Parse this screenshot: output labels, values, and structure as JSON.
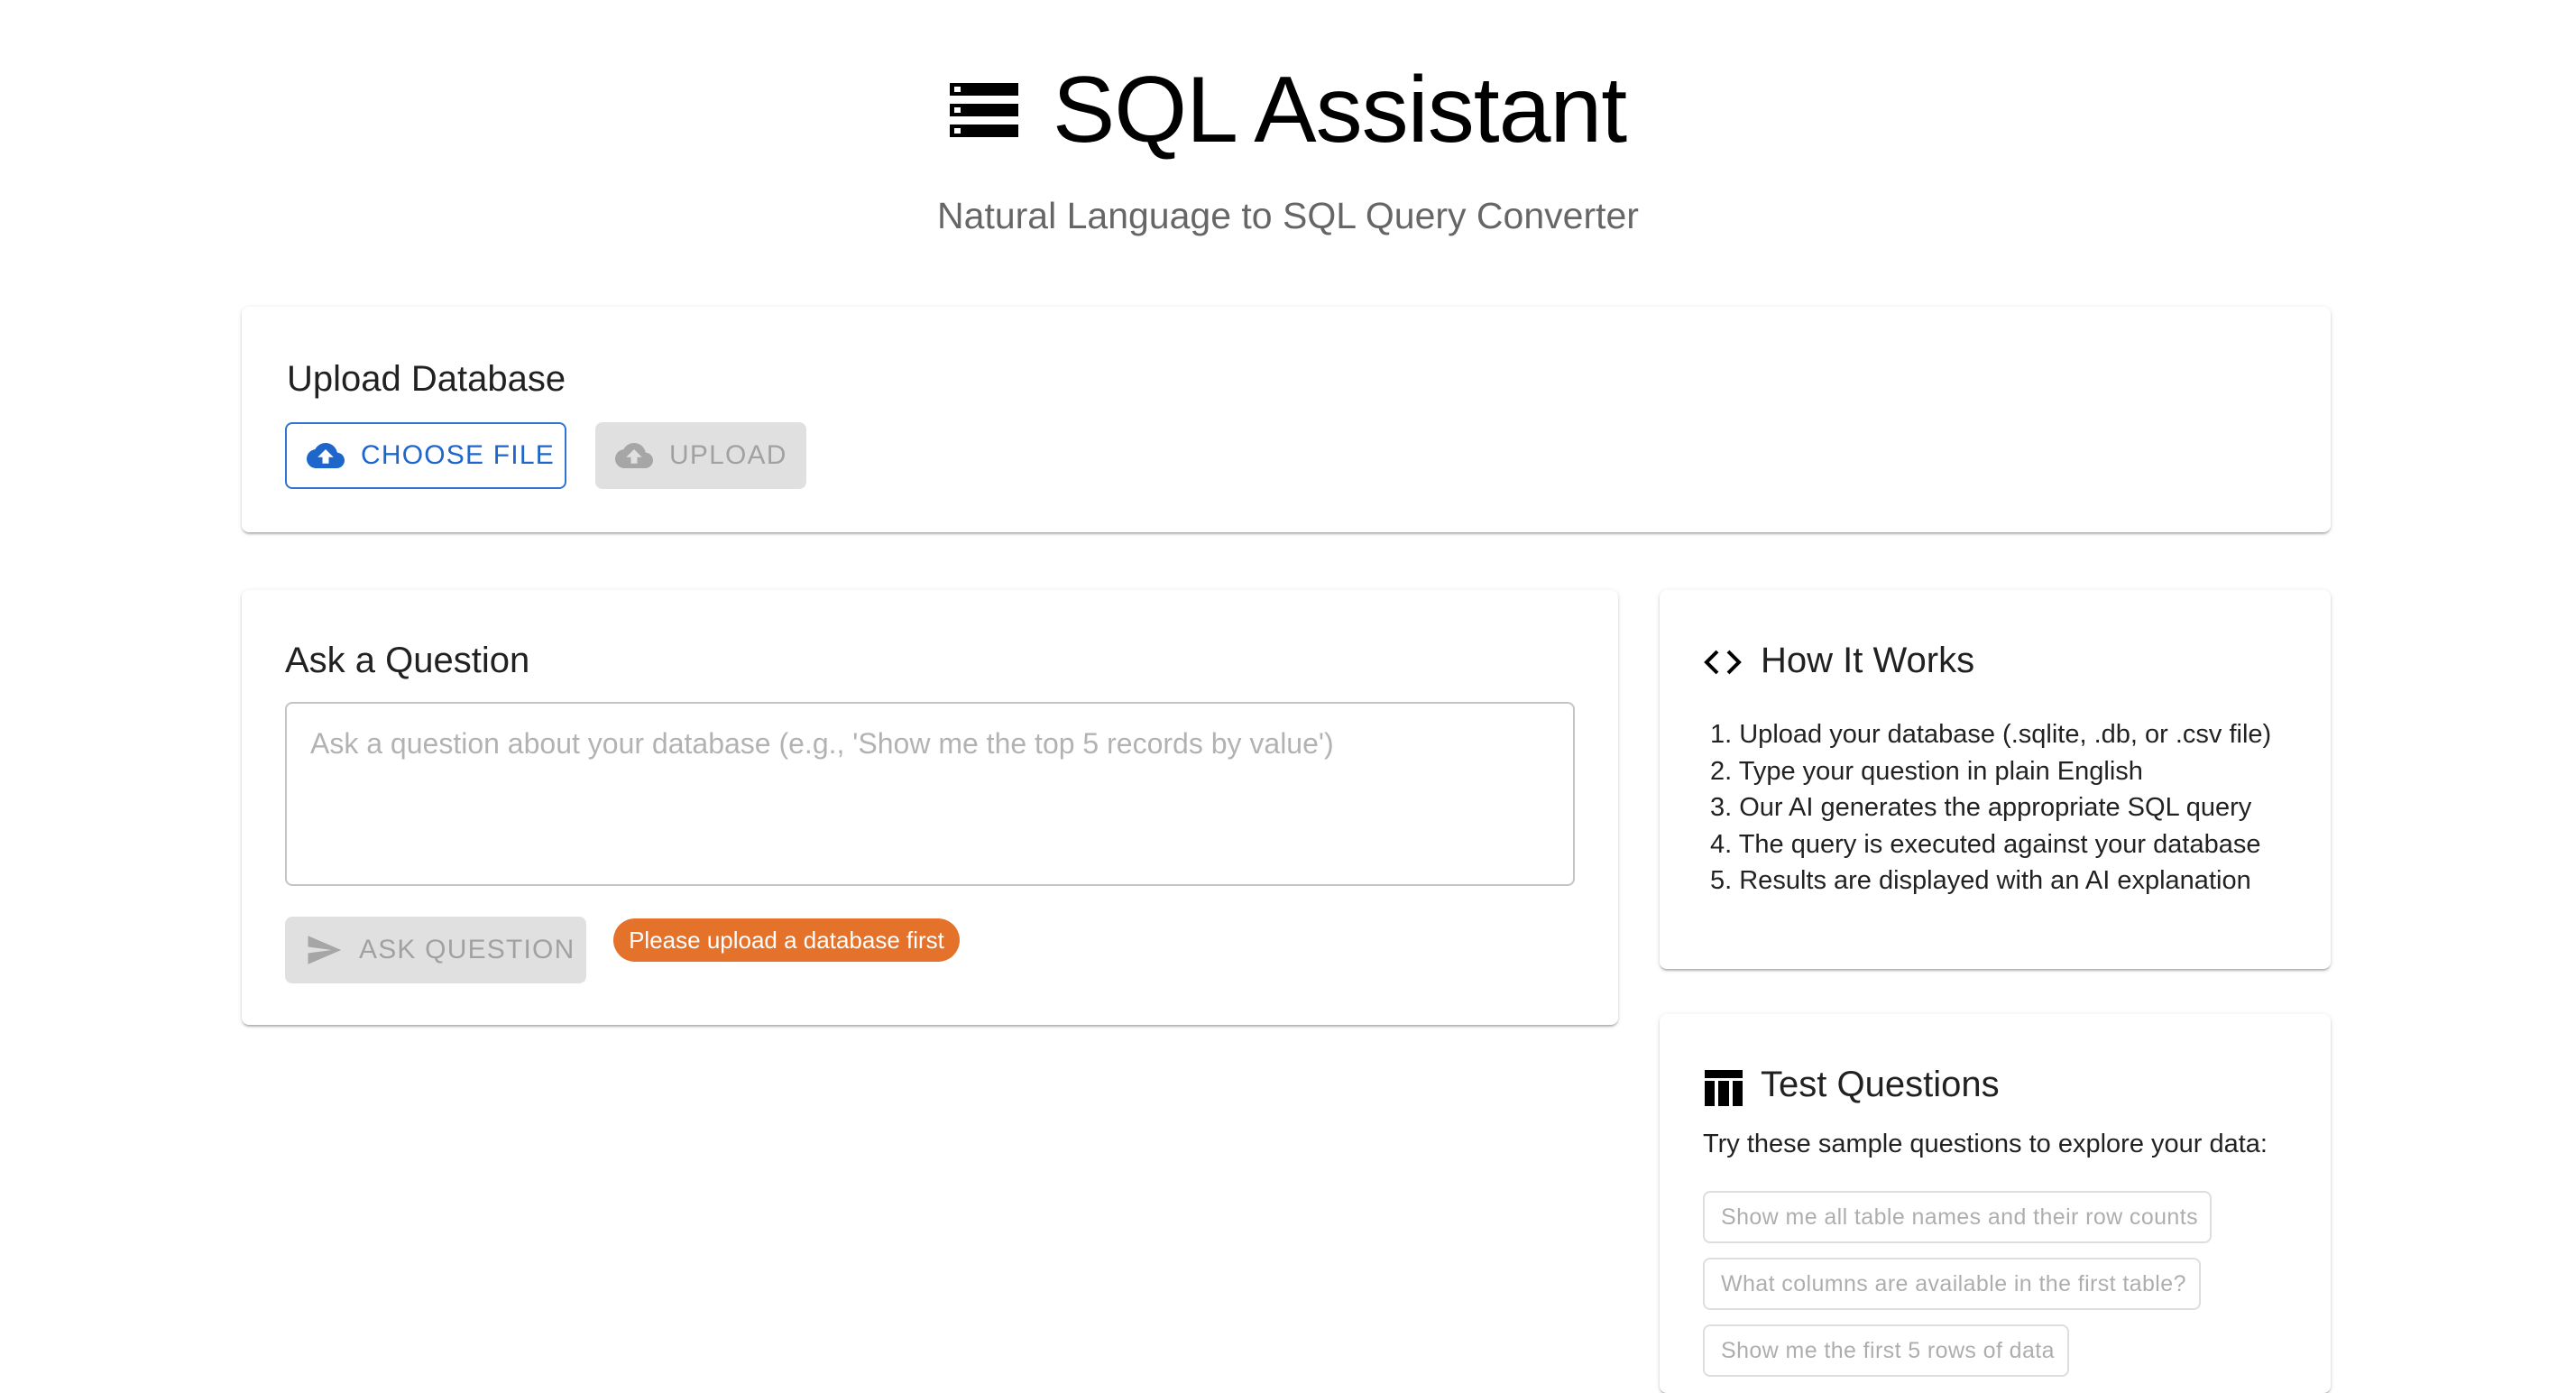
{
  "header": {
    "title": "SQL Assistant",
    "subtitle": "Natural Language to SQL Query Converter",
    "icon": "storage-icon"
  },
  "upload": {
    "title": "Upload Database",
    "choose_label": "CHOOSE FILE",
    "upload_label": "UPLOAD",
    "choose_icon": "cloud-upload-icon",
    "upload_icon": "cloud-upload-icon"
  },
  "ask": {
    "title": "Ask a Question",
    "placeholder": "Ask a question about your database (e.g., 'Show me the top 5 records by value')",
    "value": "",
    "button_label": "ASK QUESTION",
    "button_icon": "send-icon",
    "warning": "Please upload a database first"
  },
  "how": {
    "title": "How It Works",
    "icon": "code-icon",
    "steps": [
      "1. Upload your database (.sqlite, .db, or .csv file)",
      "2. Type your question in plain English",
      "3. Our AI generates the appropriate SQL query",
      "4. The query is executed against your database",
      "5. Results are displayed with an AI explanation"
    ]
  },
  "test": {
    "title": "Test Questions",
    "icon": "table-icon",
    "intro": "Try these sample questions to explore your data:",
    "questions": [
      "Show me all table names and their row counts",
      "What columns are available in the first table?",
      "Show me the first 5 rows of data"
    ]
  },
  "colors": {
    "primary": "#1e66c9",
    "warning": "#e4722a",
    "disabled_bg": "#e0e0e0"
  }
}
